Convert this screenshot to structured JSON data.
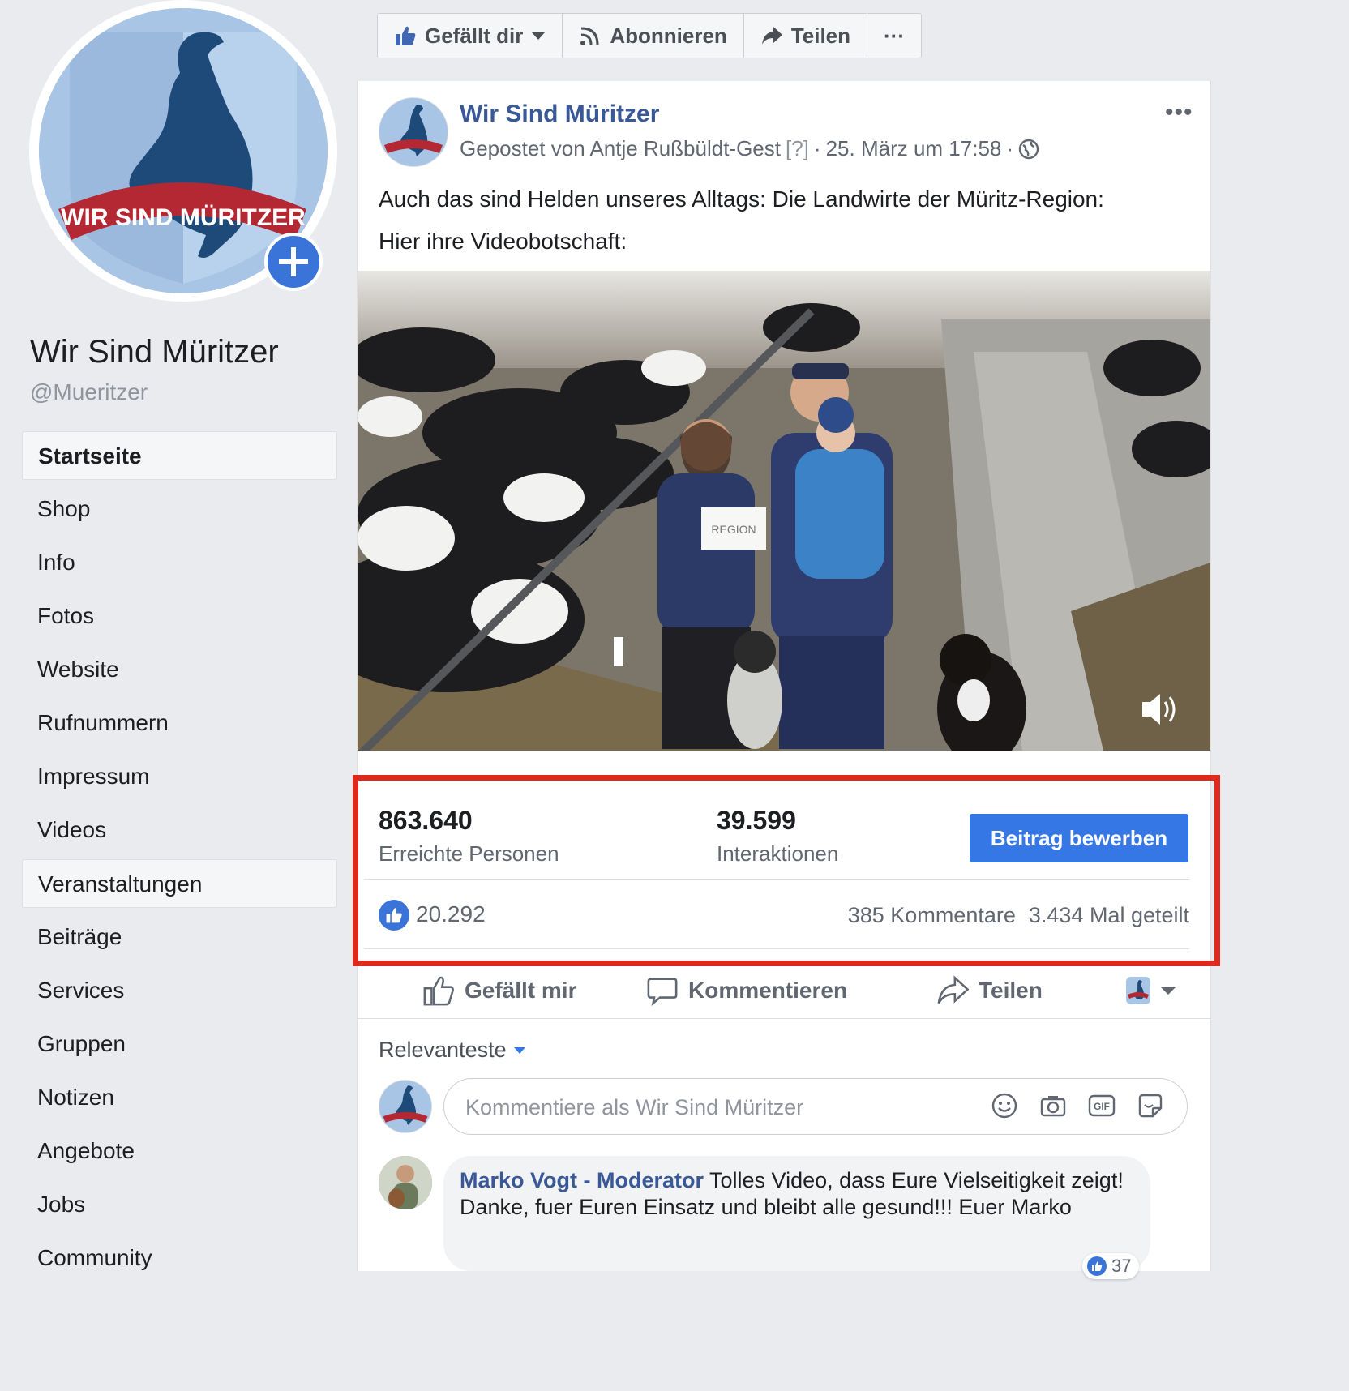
{
  "page": {
    "name": "Wir Sind Müritzer",
    "handle": "@Mueritzer",
    "logo_text": "WIR SIND MÜRITZER"
  },
  "sidebar": {
    "items": [
      {
        "label": "Startseite"
      },
      {
        "label": "Shop"
      },
      {
        "label": "Info"
      },
      {
        "label": "Fotos"
      },
      {
        "label": "Website"
      },
      {
        "label": "Rufnummern"
      },
      {
        "label": "Impressum"
      },
      {
        "label": "Videos"
      },
      {
        "label": "Veranstaltungen"
      },
      {
        "label": "Beiträge"
      },
      {
        "label": "Services"
      },
      {
        "label": "Gruppen"
      },
      {
        "label": "Notizen"
      },
      {
        "label": "Angebote"
      },
      {
        "label": "Jobs"
      },
      {
        "label": "Community"
      }
    ]
  },
  "page_actions": {
    "like_label": "Gefällt dir",
    "follow_label": "Abonnieren",
    "share_label": "Teilen",
    "more_label": "···"
  },
  "post": {
    "author": "Wir Sind Müritzer",
    "posted_by": "Gepostet von Antje Rußbüldt-Gest",
    "help_marker": "[?]",
    "separator": "·",
    "timestamp": "25. März um 17:58",
    "more_label": "•••",
    "text_line1": "Auch das sind Helden unseres Alltags: Die Landwirte der Müritz-Region:",
    "text_line2": "Hier ihre Videobotschaft:",
    "video_sign_text": "REGION"
  },
  "insights": {
    "reach_value": "863.640",
    "reach_label": "Erreichte Personen",
    "engagement_value": "39.599",
    "engagement_label": "Interaktionen",
    "boost_label": "Beitrag bewerben"
  },
  "reactions": {
    "likes": "20.292",
    "comments": "385 Kommentare",
    "shares": "3.434 Mal geteilt"
  },
  "actions": {
    "like_label": "Gefällt mir",
    "comment_label": "Kommentieren",
    "share_label": "Teilen"
  },
  "comments": {
    "sort_label": "Relevanteste",
    "input_placeholder": "Kommentiere als Wir Sind Müritzer",
    "items": [
      {
        "author": "Marko Vogt - Moderator",
        "text": "Tolles Video, dass Eure Vielseitigkeit zeigt! Danke, fuer Euren Einsatz und bleibt alle gesund!!! Euer Marko",
        "reactions": "37"
      }
    ]
  },
  "colors": {
    "link": "#385898",
    "primary_button": "#3578e5",
    "highlight_border": "#e0291d",
    "sidebar_bg": "#e9ebee",
    "logo_dark": "#1e4a7a",
    "logo_light": "#a8c5e6",
    "logo_banner": "#b32832"
  },
  "icons": {
    "page_like": "thumbs-up-icon",
    "follow": "rss-icon",
    "share": "share-arrow-icon",
    "privacy": "globe-icon",
    "volume": "volume-icon",
    "emoji": "smiley-icon",
    "camera": "camera-icon",
    "gif": "gif-icon",
    "sticker": "sticker-icon"
  }
}
